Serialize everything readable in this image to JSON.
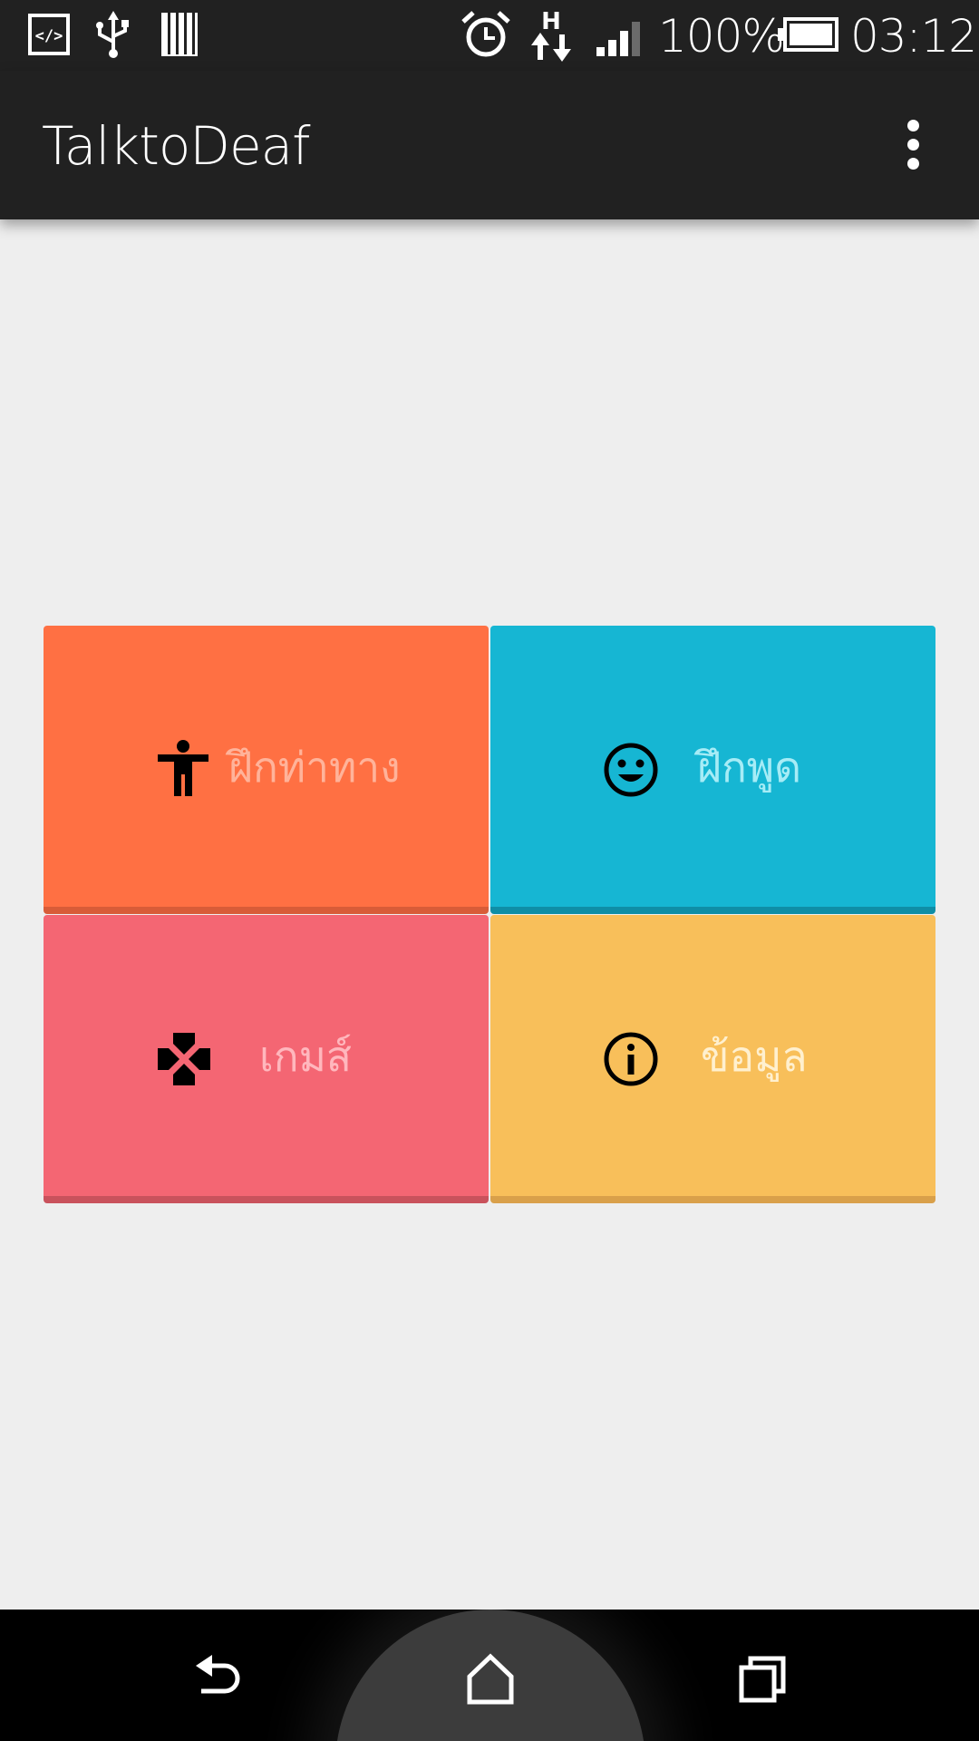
{
  "status_bar": {
    "icons": [
      "code-icon",
      "usb-icon",
      "sd-storage-icon",
      "alarm-icon",
      "hspa-data-icon",
      "signal-icon",
      "battery-icon"
    ],
    "network_type": "H",
    "battery_percent": "100%",
    "battery_level": 1.0,
    "time": "03:12"
  },
  "app_bar": {
    "title": "TalktoDeaf",
    "menu_icon": "overflow-menu-icon"
  },
  "tiles": [
    {
      "label": "ฝึกท่าทาง",
      "icon": "accessibility-icon",
      "color": "#ff7043",
      "shadow": "#d85c38",
      "text_color": "#ffb39a"
    },
    {
      "label": "ฝึกพูด",
      "icon": "smiley-icon",
      "color": "#16b6d3",
      "shadow": "#0f8ea6",
      "text_color": "#a6ecf6"
    },
    {
      "label": "เกมส์",
      "icon": "gamepad-icon",
      "color": "#f46673",
      "shadow": "#c9525c",
      "text_color": "#ffb7bd"
    },
    {
      "label": "ข้อมูล",
      "icon": "info-icon",
      "color": "#f8bf5a",
      "shadow": "#d9a04a",
      "text_color": "#fff0cf"
    }
  ],
  "nav_bar": {
    "buttons": [
      "back-icon",
      "home-icon",
      "recents-icon"
    ]
  }
}
